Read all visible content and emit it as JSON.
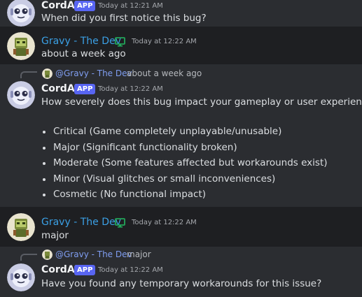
{
  "messages": [
    {
      "author": "CordAi",
      "badge": "APP",
      "timestamp": "Today at 12:21 AM",
      "text": "When did you first notice this bug?"
    },
    {
      "author": "Gravy - The Dev",
      "timestamp": "Today at 12:22 AM",
      "text": "about a week ago"
    },
    {
      "reply": {
        "mention": "@Gravy - The Dev",
        "text": "about a week ago"
      },
      "author": "CordAi",
      "badge": "APP",
      "timestamp": "Today at 12:22 AM",
      "text": "How severely does this bug impact your gameplay or user experience?",
      "options": [
        "Critical (Game completely unplayable/unusable)",
        "Major (Significant functionality broken)",
        "Moderate (Some features affected but workarounds exist)",
        "Minor (Visual glitches or small inconveniences)",
        "Cosmetic (No functional impact)"
      ]
    },
    {
      "author": "Gravy - The Dev",
      "timestamp": "Today at 12:22 AM",
      "text": "major"
    },
    {
      "reply": {
        "mention": "@Gravy - The Dev",
        "text": "major"
      },
      "author": "CordAi",
      "badge": "APP",
      "timestamp": "Today at 12:22 AM",
      "text": "Have you found any temporary workarounds for this issue?"
    }
  ],
  "colors": {
    "cordai_bg": "#2b2d31",
    "gravy_bg": "#1e1f22",
    "mention": "#3ba0e5",
    "app_badge": "#5865f2",
    "monitor_icon": "#23a55a"
  },
  "icons": {
    "cordai_avatar": "robot-avatar-icon",
    "gravy_avatar": "game-character-avatar-icon",
    "dev_badge": "monitor-icon"
  }
}
